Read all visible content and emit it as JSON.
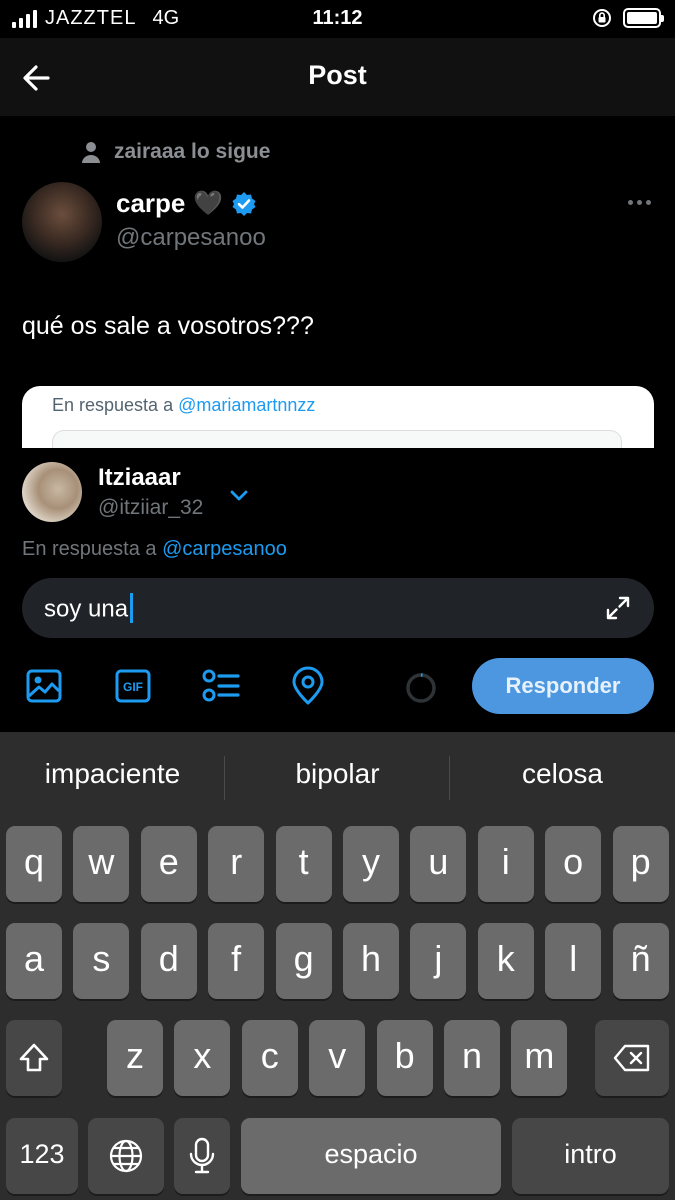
{
  "status_bar": {
    "carrier": "JAZZTEL",
    "network": "4G",
    "time": "11:12"
  },
  "header": {
    "title": "Post",
    "back_icon": "arrow-left-icon"
  },
  "tweet": {
    "social_context": "zairaaa lo sigue",
    "author_name": "carpe",
    "author_emoji": "🖤",
    "author_handle": "@carpesanoo",
    "text": "qué os sale a vosotros???",
    "media": {
      "reply_prefix": "En respuesta a",
      "reply_handle": "@mariamartnnzz"
    }
  },
  "composer": {
    "user_name": "Itziaaar",
    "user_handle": "@itziiar_32",
    "reply_prefix": "En respuesta a",
    "reply_handle": "@carpesanoo",
    "input_value": "soy una",
    "submit_label": "Responder",
    "accent_color": "#1d9bf0"
  },
  "keyboard": {
    "suggestions": [
      "impaciente",
      "bipolar",
      "celosa"
    ],
    "row1": [
      "q",
      "w",
      "e",
      "r",
      "t",
      "y",
      "u",
      "i",
      "o",
      "p"
    ],
    "row2": [
      "a",
      "s",
      "d",
      "f",
      "g",
      "h",
      "j",
      "k",
      "l",
      "ñ"
    ],
    "row3": [
      "z",
      "x",
      "c",
      "v",
      "b",
      "n",
      "m"
    ],
    "numbers_label": "123",
    "space_label": "espacio",
    "return_label": "intro"
  }
}
